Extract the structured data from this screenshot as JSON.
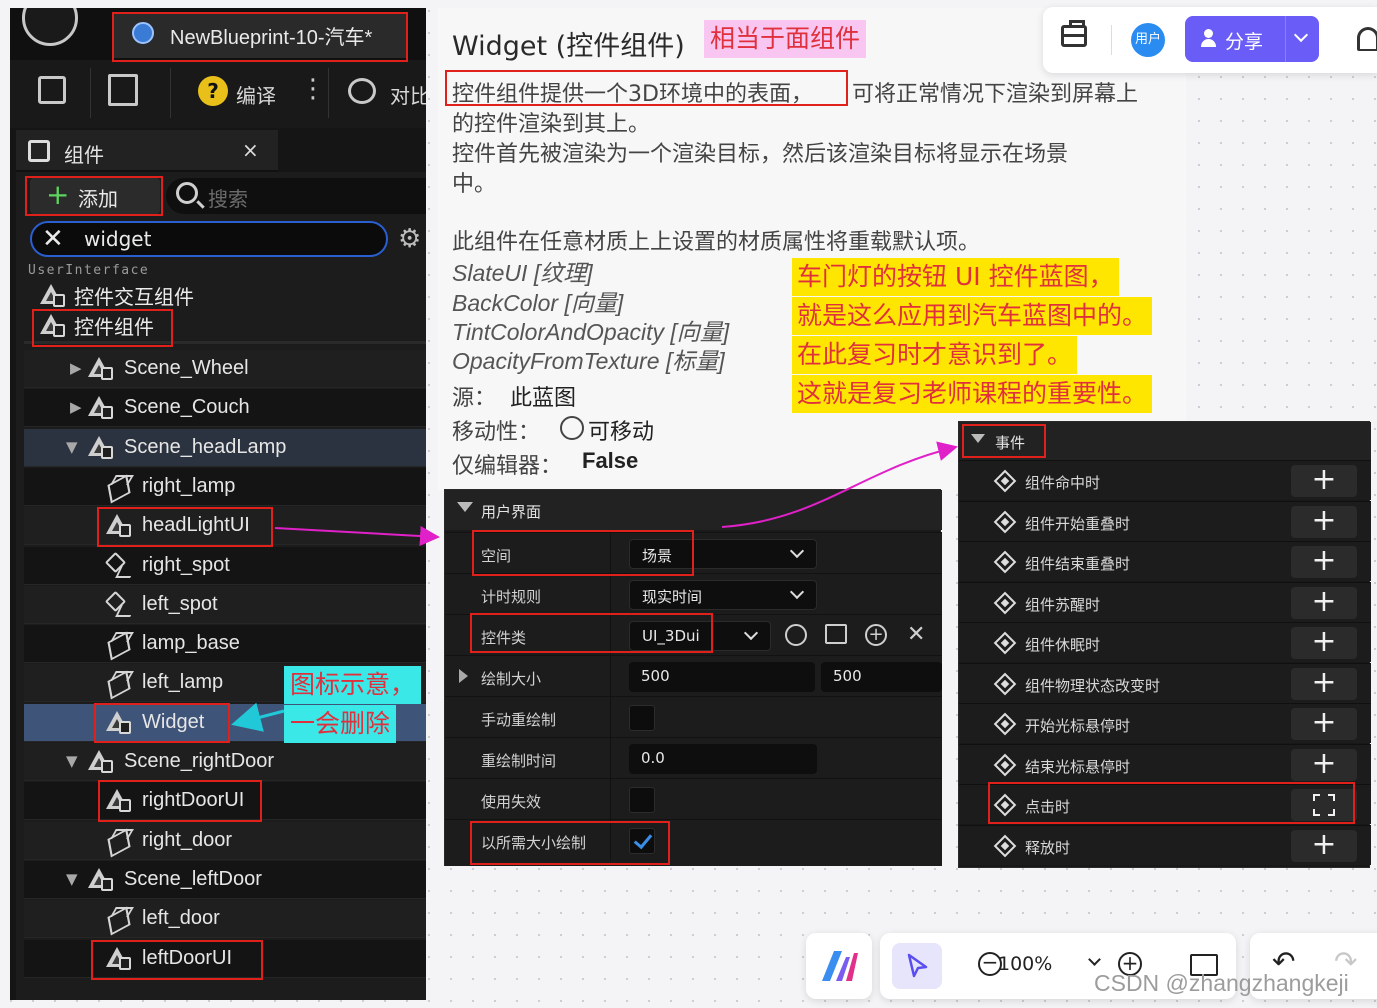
{
  "editor": {
    "blueprint_tab": "NewBlueprint-10-汽车*",
    "toolbar": {
      "compile_label": "编译",
      "compare_label": "对比"
    },
    "components": {
      "title": "组件",
      "close": "×",
      "add_label": "添加",
      "search_placeholder": "搜索",
      "filter_value": "widget",
      "category": "UserInterface",
      "results": [
        "控件交互组件",
        "控件组件"
      ],
      "tree": [
        {
          "label": "Scene_Wheel",
          "icon": "scene-component-icon"
        },
        {
          "label": "Scene_Couch",
          "icon": "scene-component-icon"
        },
        {
          "label": "Scene_headLamp",
          "icon": "scene-component-icon"
        },
        {
          "label": "right_lamp",
          "icon": "static-mesh-icon"
        },
        {
          "label": "headLightUI",
          "icon": "widget-component-icon"
        },
        {
          "label": "right_spot",
          "icon": "spot-light-icon"
        },
        {
          "label": "left_spot",
          "icon": "spot-light-icon"
        },
        {
          "label": "lamp_base",
          "icon": "static-mesh-icon"
        },
        {
          "label": "left_lamp",
          "icon": "static-mesh-icon"
        },
        {
          "label": "Widget",
          "icon": "widget-component-icon"
        },
        {
          "label": "Scene_rightDoor",
          "icon": "scene-component-icon"
        },
        {
          "label": "rightDoorUI",
          "icon": "widget-component-icon"
        },
        {
          "label": "right_door",
          "icon": "static-mesh-icon"
        },
        {
          "label": "Scene_leftDoor",
          "icon": "scene-component-icon"
        },
        {
          "label": "left_door",
          "icon": "static-mesh-icon"
        },
        {
          "label": "leftDoorUI",
          "icon": "widget-component-icon"
        }
      ]
    }
  },
  "notes": {
    "widget_note_1": "图标示意，",
    "widget_note_2": "一会删除",
    "yellow": [
      "车门灯的按钮 UI 控件蓝图，",
      "就是这么应用到汽车蓝图中的。",
      "在此复习时才意识到了。",
      "这就是复习老师课程的重要性。"
    ],
    "title_tag": "相当于面组件"
  },
  "doc": {
    "title": "Widget (控件组件)",
    "line1_a": "控件组件提供一个3D环境中的表面，",
    "line1_b": "可将正常情况下渲染到屏幕上",
    "line2": "的控件渲染到其上。",
    "line3": "控件首先被渲染为一个渲染目标，然后该渲染目标将显示在场景",
    "line4": "中。",
    "line5": "此组件在任意材质上上设置的材质属性将重载默认项。",
    "params": [
      "SlateUI [纹理]",
      "BackColor [向量]",
      "TintColorAndOpacity [向量]",
      "OpacityFromTexture [标量]"
    ],
    "source_label": "源：",
    "source_value": "此蓝图",
    "mobility_label": "移动性：",
    "mobility_value": "可移动",
    "editor_only_label": "仅编辑器：",
    "editor_only_value": "False"
  },
  "ui_panel": {
    "header": "用户界面",
    "space_label": "空间",
    "space_value": "场景",
    "timing_label": "计时规则",
    "timing_value": "现实时间",
    "class_label": "控件类",
    "class_value": "UI_3Dui",
    "draw_size_label": "绘制大小",
    "draw_size_x": "500",
    "draw_size_y": "500",
    "manual_redraw_label": "手动重绘制",
    "manual_redraw": false,
    "redraw_time_label": "重绘制时间",
    "redraw_time_value": "0.0",
    "disabled_label": "使用失效",
    "disabled": false,
    "desired_size_label": "以所需大小绘制",
    "desired_size": true
  },
  "events": {
    "header": "事件",
    "items": [
      "组件命中时",
      "组件开始重叠时",
      "组件结束重叠时",
      "组件苏醒时",
      "组件休眠时",
      "组件物理状态改变时",
      "开始光标悬停时",
      "结束光标悬停时",
      "点击时",
      "释放时"
    ]
  },
  "appbar": {
    "avatar_label": "用户",
    "share_label": "分享"
  },
  "bottom": {
    "zoom": "100%"
  },
  "watermark": "CSDN @zhangzhangkeji",
  "colors": {
    "annotation_red": "#e0201a",
    "arrow_magenta": "#e020c8",
    "arrow_cyan": "#20c8d8",
    "share_purple": "#6a5cf6"
  }
}
